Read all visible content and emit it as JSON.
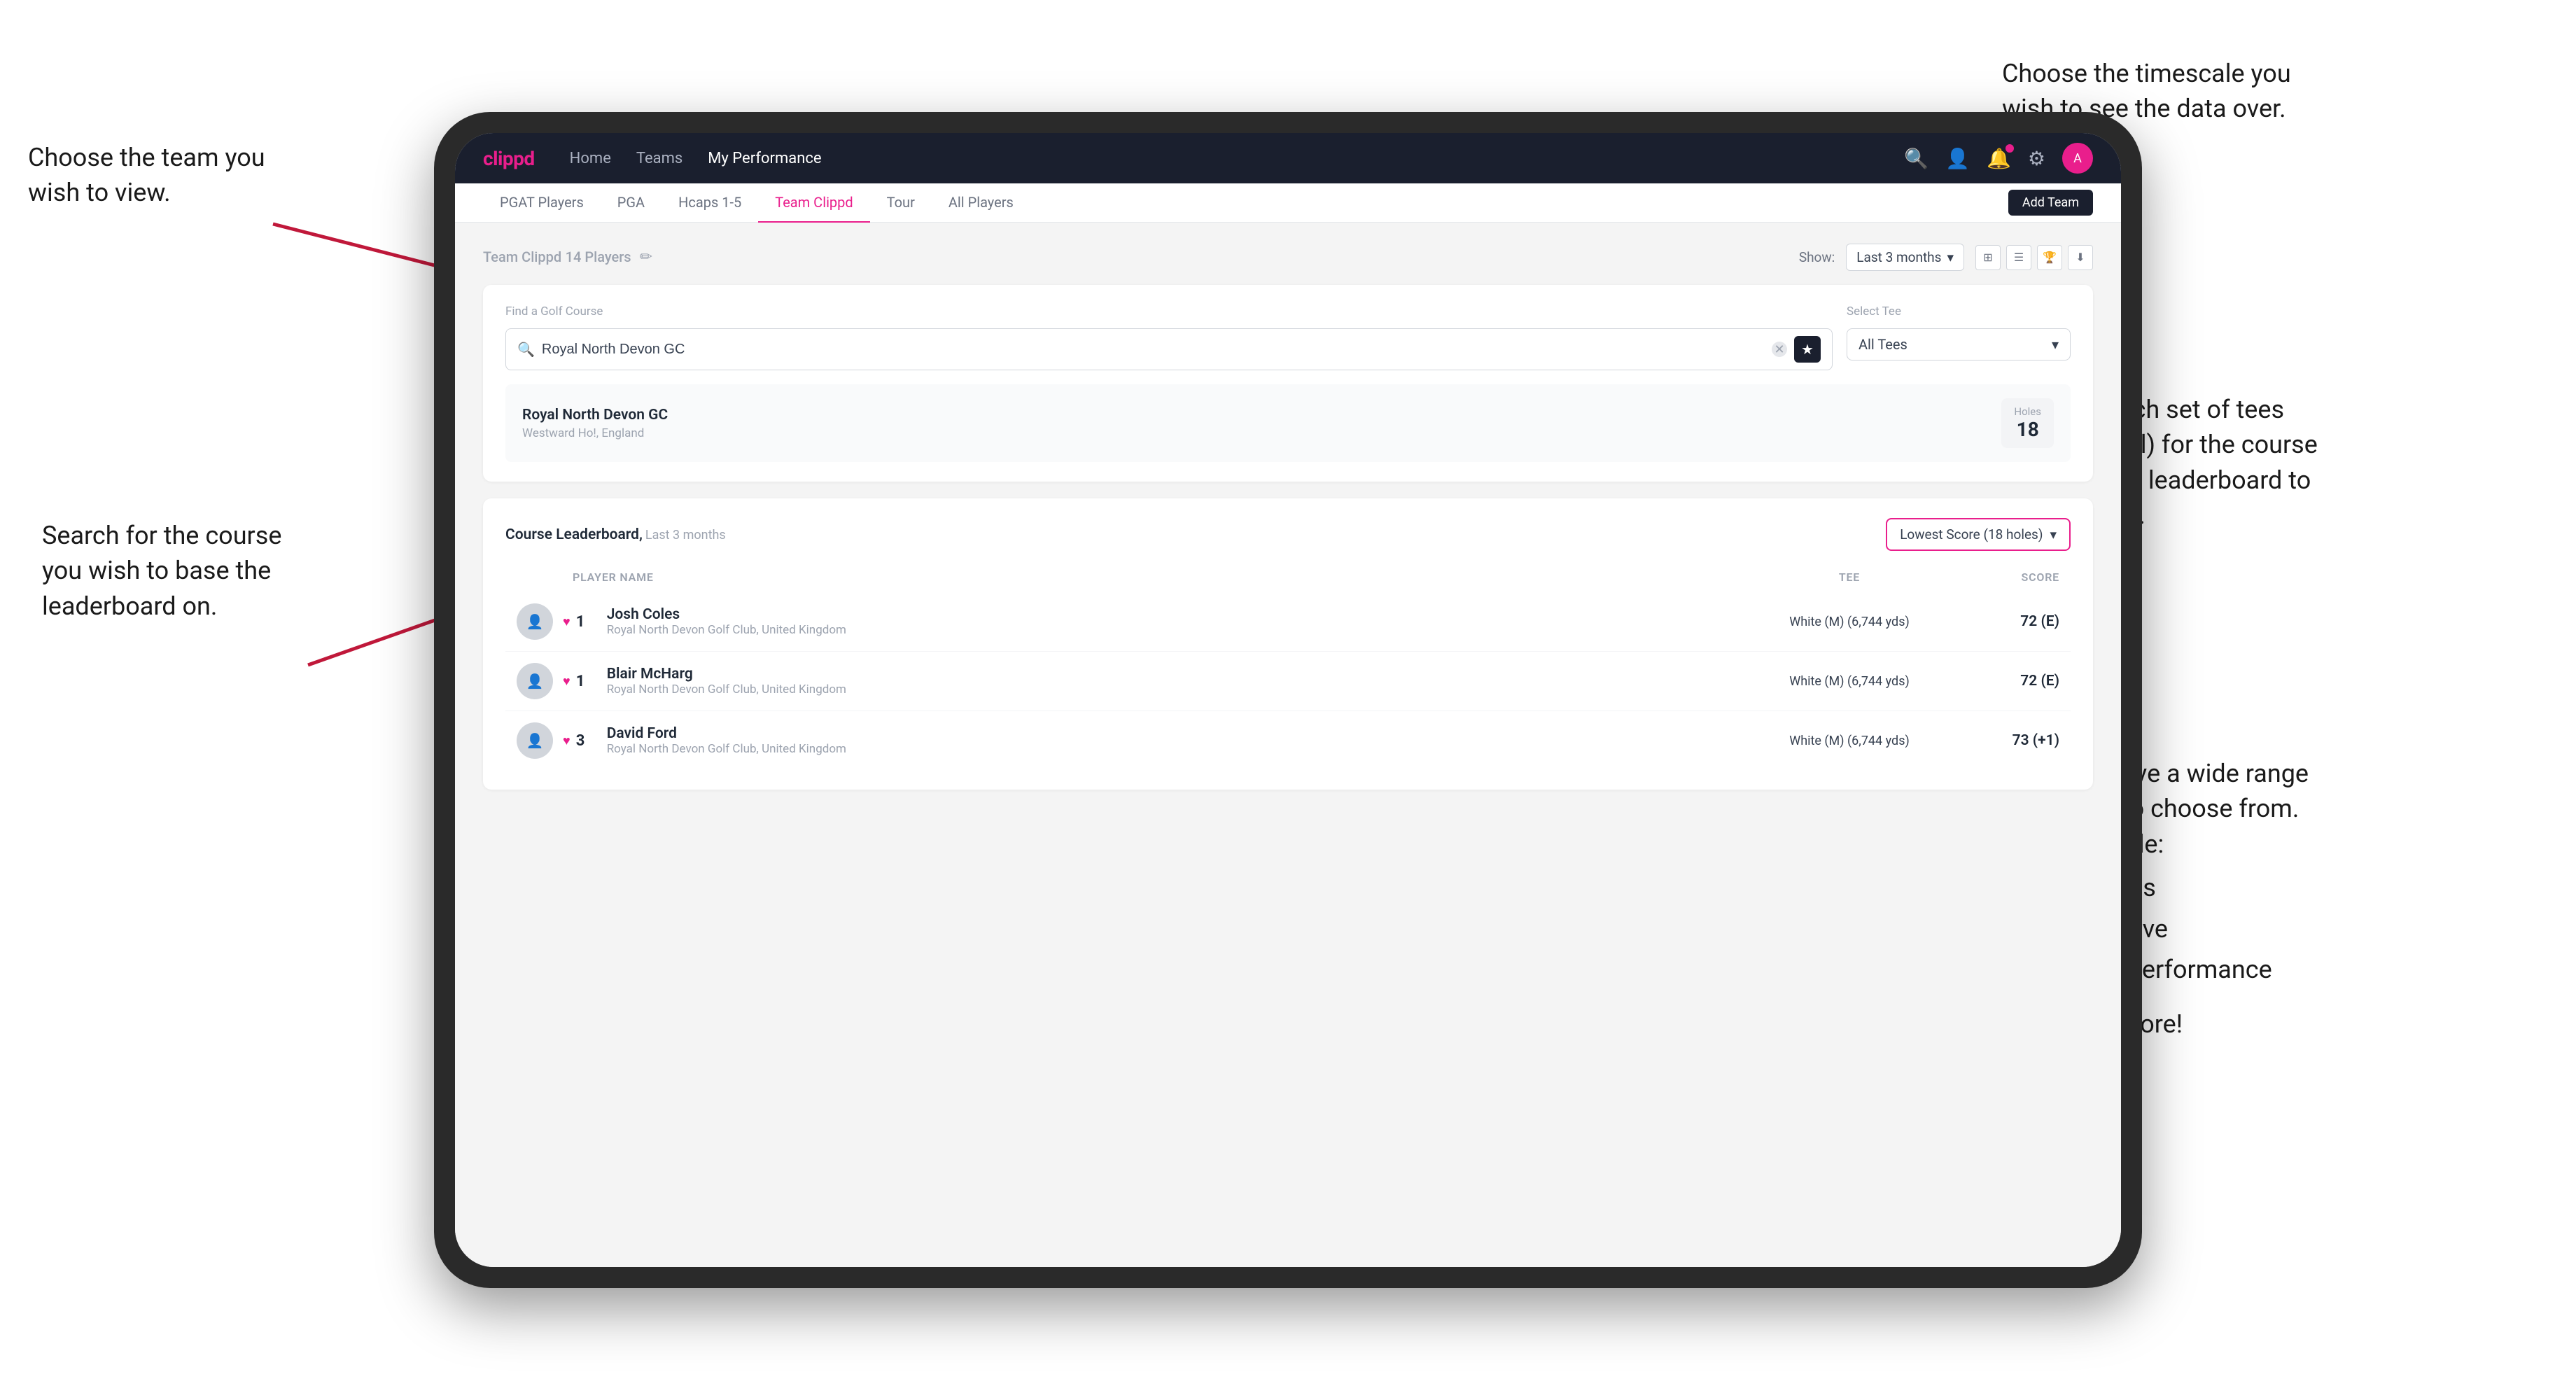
{
  "app": {
    "logo": "clippd",
    "nav": {
      "links": [
        "Home",
        "Teams",
        "My Performance"
      ]
    },
    "subnav": {
      "tabs": [
        "PGAT Players",
        "PGA",
        "Hcaps 1-5",
        "Team Clippd",
        "Tour",
        "All Players"
      ],
      "active": "Team Clippd",
      "add_team_label": "Add Team"
    }
  },
  "team": {
    "name": "Team Clippd",
    "player_count": "14 Players",
    "show_label": "Show:",
    "timeframe": "Last 3 months"
  },
  "course_search": {
    "find_label": "Find a Golf Course",
    "placeholder": "Royal North Devon GC",
    "tee_label": "Select Tee",
    "tee_value": "All Tees",
    "result": {
      "name": "Royal North Devon GC",
      "location": "Westward Ho!, England",
      "holes_label": "Holes",
      "holes_value": "18"
    }
  },
  "leaderboard": {
    "title": "Course Leaderboard,",
    "subtitle": "Last 3 months",
    "score_type": "Lowest Score (18 holes)",
    "columns": {
      "player": "PLAYER NAME",
      "tee": "TEE",
      "score": "SCORE"
    },
    "players": [
      {
        "rank": "1",
        "name": "Josh Coles",
        "club": "Royal North Devon Golf Club, United Kingdom",
        "tee": "White (M) (6,744 yds)",
        "score": "72 (E)"
      },
      {
        "rank": "1",
        "name": "Blair McHarg",
        "club": "Royal North Devon Golf Club, United Kingdom",
        "tee": "White (M) (6,744 yds)",
        "score": "72 (E)"
      },
      {
        "rank": "3",
        "name": "David Ford",
        "club": "Royal North Devon Golf Club, United Kingdom",
        "tee": "White (M) (6,744 yds)",
        "score": "73 (+1)"
      }
    ]
  },
  "annotations": {
    "team_choice": "Choose the team you\nwish to view.",
    "timescale": "Choose the timescale you\nwish to see the data over.",
    "tees": "Choose which set of tees\n(default is all) for the course\nyou wish the leaderboard to\nbe based on.",
    "search": "Search for the course\nyou wish to base the\nleaderboard on.",
    "options_intro": "Here you have a wide range\nof options to choose from.\nThese include:",
    "options_list": [
      "Most birdies",
      "Longest drive",
      "Best APP performance"
    ],
    "options_outro": "and many more!"
  }
}
